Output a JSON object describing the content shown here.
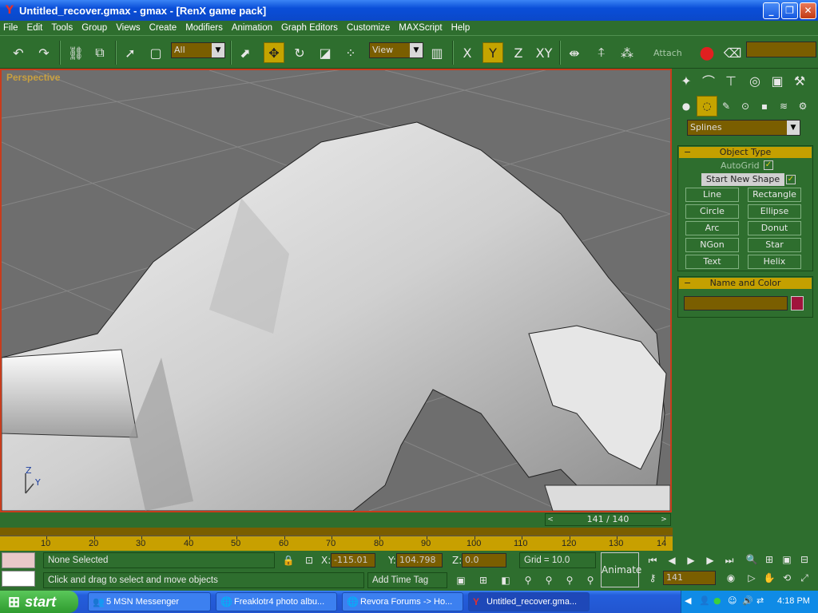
{
  "window": {
    "title": "Untitled_recover.gmax - gmax - [RenX game pack]",
    "min": "_",
    "max": "❐",
    "close": "✕"
  },
  "menu": [
    "File",
    "Edit",
    "Tools",
    "Group",
    "Views",
    "Create",
    "Modifiers",
    "Animation",
    "Graph Editors",
    "Customize",
    "MAXScript",
    "Help"
  ],
  "toolbar": {
    "selection_filter": "All",
    "ref_coord": "View",
    "axis_x": "X",
    "axis_y": "Y",
    "axis_z": "Z",
    "axis_xy": "XY",
    "attach": "Attach"
  },
  "viewport": {
    "label": "Perspective",
    "axis_z": "Z",
    "axis_y": "Y"
  },
  "cmdpanel": {
    "category": "Splines",
    "object_type_title": "Object Type",
    "autogrid_label": "AutoGrid",
    "autogrid_checked": true,
    "start_new_shape_label": "Start New Shape",
    "start_new_shape_checked": true,
    "buttons": [
      "Line",
      "Rectangle",
      "Circle",
      "Ellipse",
      "Arc",
      "Donut",
      "NGon",
      "Star",
      "Text",
      "Helix"
    ],
    "name_color_title": "Name and Color",
    "object_color": "#a0143c"
  },
  "timeline": {
    "frame_display": "141 / 140",
    "ticks": [
      "10",
      "20",
      "30",
      "40",
      "50",
      "60",
      "70",
      "80",
      "90",
      "100",
      "110",
      "120",
      "130",
      "14"
    ]
  },
  "status": {
    "selection": "None Selected",
    "prompt": "Click and drag to select and move objects",
    "x_label": "X:",
    "x_value": "-115.01",
    "y_label": "Y:",
    "y_value": "104.798",
    "z_label": "Z:",
    "z_value": "0.0",
    "grid": "Grid = 10.0",
    "add_time_tag": "Add Time Tag",
    "animate": "Animate",
    "frame": "141"
  },
  "taskbar": {
    "start": "start",
    "tasks": [
      "5 MSN Messenger",
      "Freaklotr4 photo albu...",
      "Revora Forums -> Ho...",
      "Untitled_recover.gma..."
    ],
    "time": "4:18 PM"
  }
}
